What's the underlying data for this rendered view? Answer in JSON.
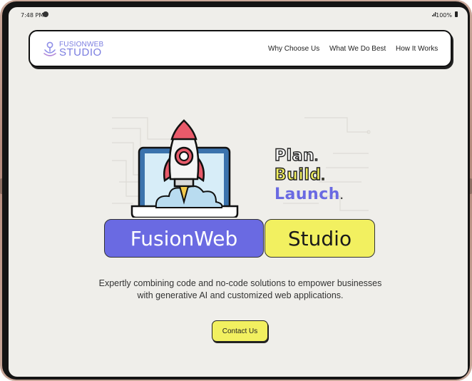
{
  "status_bar": {
    "time": "7:48 PM",
    "battery": "100%"
  },
  "logo": {
    "line1": "FUSIONWEB",
    "line2": "STUDIO"
  },
  "nav": {
    "links": [
      "Why Choose Us",
      "What We Do Best",
      "How It Works"
    ]
  },
  "hero": {
    "tagline": [
      {
        "word": "Plan",
        "color": "#ffffff"
      },
      {
        "word": "Build",
        "color": "#f2f060"
      },
      {
        "word": "Launch",
        "color": "#6a6ae2"
      }
    ],
    "period": ".",
    "badge_primary": "FusionWeb",
    "badge_secondary": "Studio",
    "description": "Expertly combining code and no-code solutions to empower businesses with generative AI and customized web applications.",
    "cta_label": "Contact Us"
  },
  "colors": {
    "background": "#efeeea",
    "accent_blue": "#6a6ae2",
    "accent_yellow": "#f2f060",
    "logo": "#7b7ee0"
  }
}
